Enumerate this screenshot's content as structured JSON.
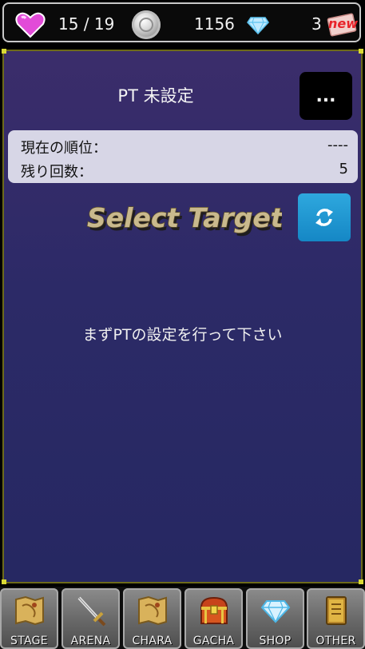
{
  "status_bar": {
    "stamina": "15 / 19",
    "coins": "1156",
    "gems": "3",
    "new_badge": "new",
    "icons": {
      "stamina": "heart-icon",
      "coins": "silver-coin-icon",
      "gems": "diamond-icon",
      "ticket": "ticket-icon"
    }
  },
  "party": {
    "title": "PT 未設定",
    "menu_label": "..."
  },
  "info": {
    "rank_label": "現在の順位：",
    "rank_value": "----",
    "remaining_label": "残り回数：",
    "remaining_value": "5"
  },
  "select_target": {
    "label": "Select Target",
    "refresh_icon": "refresh-icon"
  },
  "message": "まずPTの設定を行って下さい",
  "bottom_nav": [
    {
      "label": "STAGE",
      "icon": "map-icon"
    },
    {
      "label": "ARENA",
      "icon": "sword-icon"
    },
    {
      "label": "CHARA",
      "icon": "map-icon"
    },
    {
      "label": "GACHA",
      "icon": "treasure-chest-icon"
    },
    {
      "label": "SHOP",
      "icon": "diamond-icon"
    },
    {
      "label": "OTHER",
      "icon": "book-icon"
    }
  ],
  "colors": {
    "panel_bg": "#2c2a67",
    "refresh_button": "#1d95d1",
    "info_box": "#d7d6e6"
  }
}
